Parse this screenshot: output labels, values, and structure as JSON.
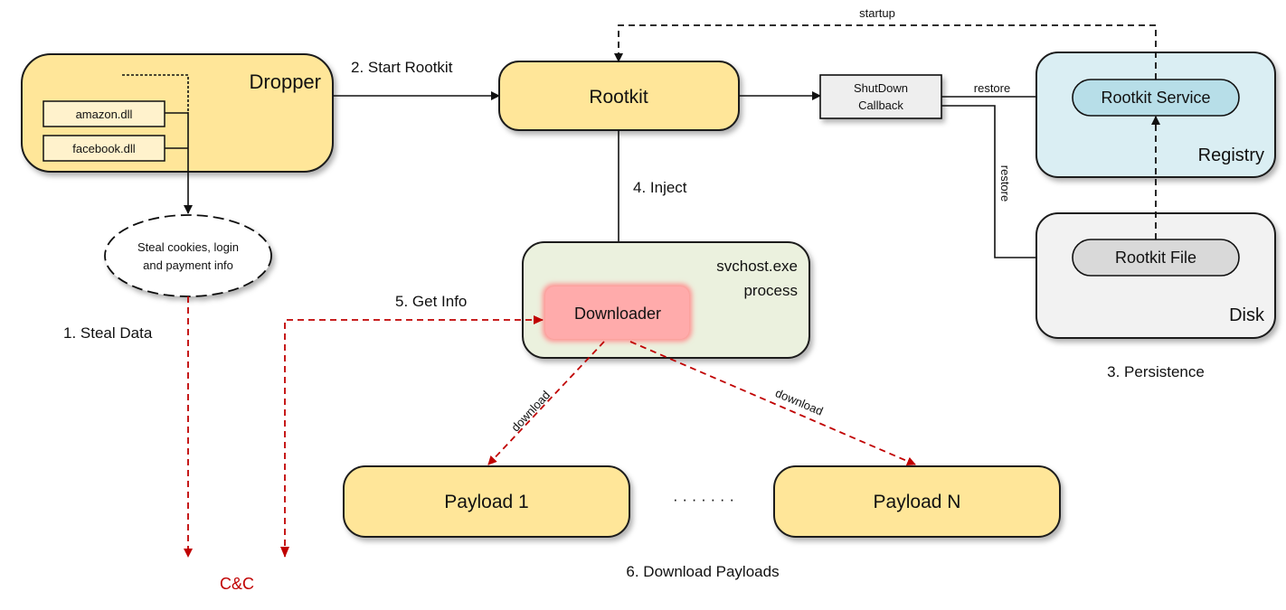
{
  "colors": {
    "dropper": "#FFE699",
    "dll": "#FFF2CC",
    "registry": "#DAEEF3",
    "service": "#B7DEE8",
    "disk": "#F2F2F2",
    "file": "#D9D9D9",
    "svchost": "#EBF1DE",
    "downloader": "#FFABAB",
    "callback": "#EEEEEE",
    "cc": "#C00000"
  },
  "dropper": {
    "label": "Dropper",
    "dlls": [
      "amazon.dll",
      "facebook.dll"
    ]
  },
  "steal": {
    "ellipse": [
      "Steal cookies, login",
      "and payment info"
    ],
    "step": "1. Steal Data"
  },
  "start_rootkit": "2. Start Rootkit",
  "rootkit": "Rootkit",
  "callback": [
    "ShutDown",
    "Callback"
  ],
  "restore1": "restore",
  "restore2": "restore",
  "startup": "startup",
  "registry": {
    "label": "Registry",
    "item": "Rootkit Service"
  },
  "disk": {
    "label": "Disk",
    "item": "Rootkit File"
  },
  "persistence": "3. Persistence",
  "inject": "4. Inject",
  "svchost": [
    "svchost.exe",
    "process"
  ],
  "downloader": "Downloader",
  "get_info": "5. Get Info",
  "download1": "download",
  "download2": "download",
  "payloads": [
    "Payload 1",
    "Payload N"
  ],
  "ellipsis": "· · · · · · ·",
  "download_payloads": "6. Download Payloads",
  "cc": "C&C"
}
